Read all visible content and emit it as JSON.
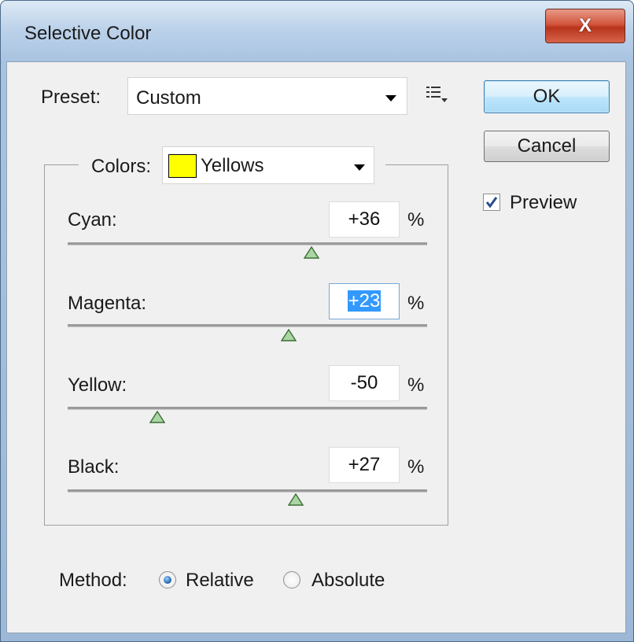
{
  "window": {
    "title": "Selective Color",
    "close_glyph": "X"
  },
  "preset": {
    "label": "Preset:",
    "value": "Custom",
    "menu_icon": "preset-options-icon"
  },
  "buttons": {
    "ok": "OK",
    "cancel": "Cancel"
  },
  "preview": {
    "label": "Preview",
    "checked": true
  },
  "colors": {
    "label": "Colors:",
    "value": "Yellows",
    "swatch_color": "#ffff00"
  },
  "sliders": [
    {
      "label": "Cyan:",
      "value": "+36",
      "unit": "%"
    },
    {
      "label": "Magenta:",
      "value": "+23",
      "unit": "%"
    },
    {
      "label": "Yellow:",
      "value": "-50",
      "unit": "%"
    },
    {
      "label": "Black:",
      "value": "+27",
      "unit": "%"
    }
  ],
  "method": {
    "label": "Method:",
    "options": [
      "Relative",
      "Absolute"
    ],
    "selected": "Relative"
  },
  "colors_theme": {
    "accent": "#3399ff",
    "close_red": "#c8412a",
    "thumb_green": "#7ab87a"
  }
}
